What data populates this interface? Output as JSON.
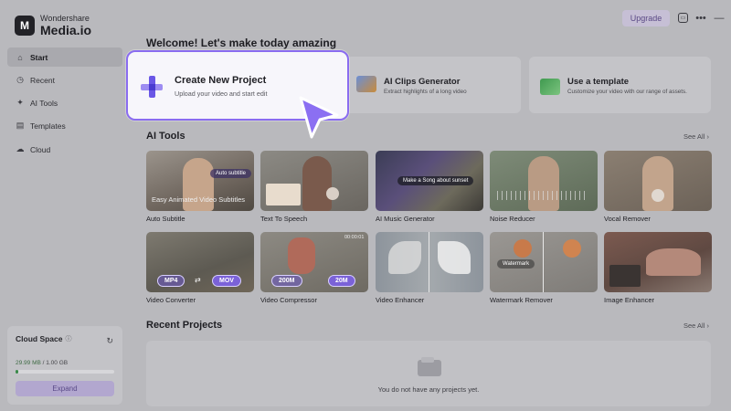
{
  "app": {
    "brand": "Wondershare",
    "product": "Media.io",
    "logo_letter": "M"
  },
  "topbar": {
    "upgrade_label": "Upgrade",
    "icons": [
      "window-icon",
      "more-icon",
      "minimize-icon"
    ]
  },
  "sidebar": {
    "items": [
      {
        "label": "Start",
        "icon": "home-icon",
        "active": true
      },
      {
        "label": "Recent",
        "icon": "clock-icon",
        "active": false
      },
      {
        "label": "AI Tools",
        "icon": "sparkle-icon",
        "active": false
      },
      {
        "label": "Templates",
        "icon": "template-icon",
        "active": false
      },
      {
        "label": "Cloud",
        "icon": "cloud-icon",
        "active": false
      }
    ],
    "cloud": {
      "title": "Cloud Space",
      "used": "29.99 MB",
      "total": "1.00 GB",
      "separator": " / ",
      "used_fraction": 0.03,
      "expand_label": "Expand"
    }
  },
  "main": {
    "welcome": "Welcome! Let's make today amazing",
    "quick_cards": [
      {
        "title": "Create New Project",
        "desc": "Upload your video and start edit"
      },
      {
        "title": "AI Clips Generator",
        "desc": "Extract highlights of a long video"
      },
      {
        "title": "Use a template",
        "desc": "Customize your video with our range of assets."
      }
    ],
    "ai_tools": {
      "title": "AI Tools",
      "see_all": "See All",
      "items": [
        {
          "label": "Auto Subtitle",
          "overlay": "Easy Animated Video Subtitles",
          "badge": "Auto subtitle"
        },
        {
          "label": "Text To Speech"
        },
        {
          "label": "AI Music Generator",
          "badge": "Make a Song about sunset"
        },
        {
          "label": "Noise Reducer"
        },
        {
          "label": "Vocal Remover"
        },
        {
          "label": "Video Converter",
          "from": "MP4",
          "to": "MOV"
        },
        {
          "label": "Video Compressor",
          "from": "200M",
          "to": "20M",
          "timecode": "00:00:01"
        },
        {
          "label": "Video Enhancer"
        },
        {
          "label": "Watermark Remover",
          "badge": "Watermark"
        },
        {
          "label": "Image Enhancer"
        }
      ]
    },
    "recent": {
      "title": "Recent Projects",
      "see_all": "See All",
      "empty_text": "You do not have any projects yet."
    }
  },
  "colors": {
    "accent": "#8a6cf0",
    "overlay": "#b9b9bd",
    "upgrade_text": "#5b4a86"
  }
}
